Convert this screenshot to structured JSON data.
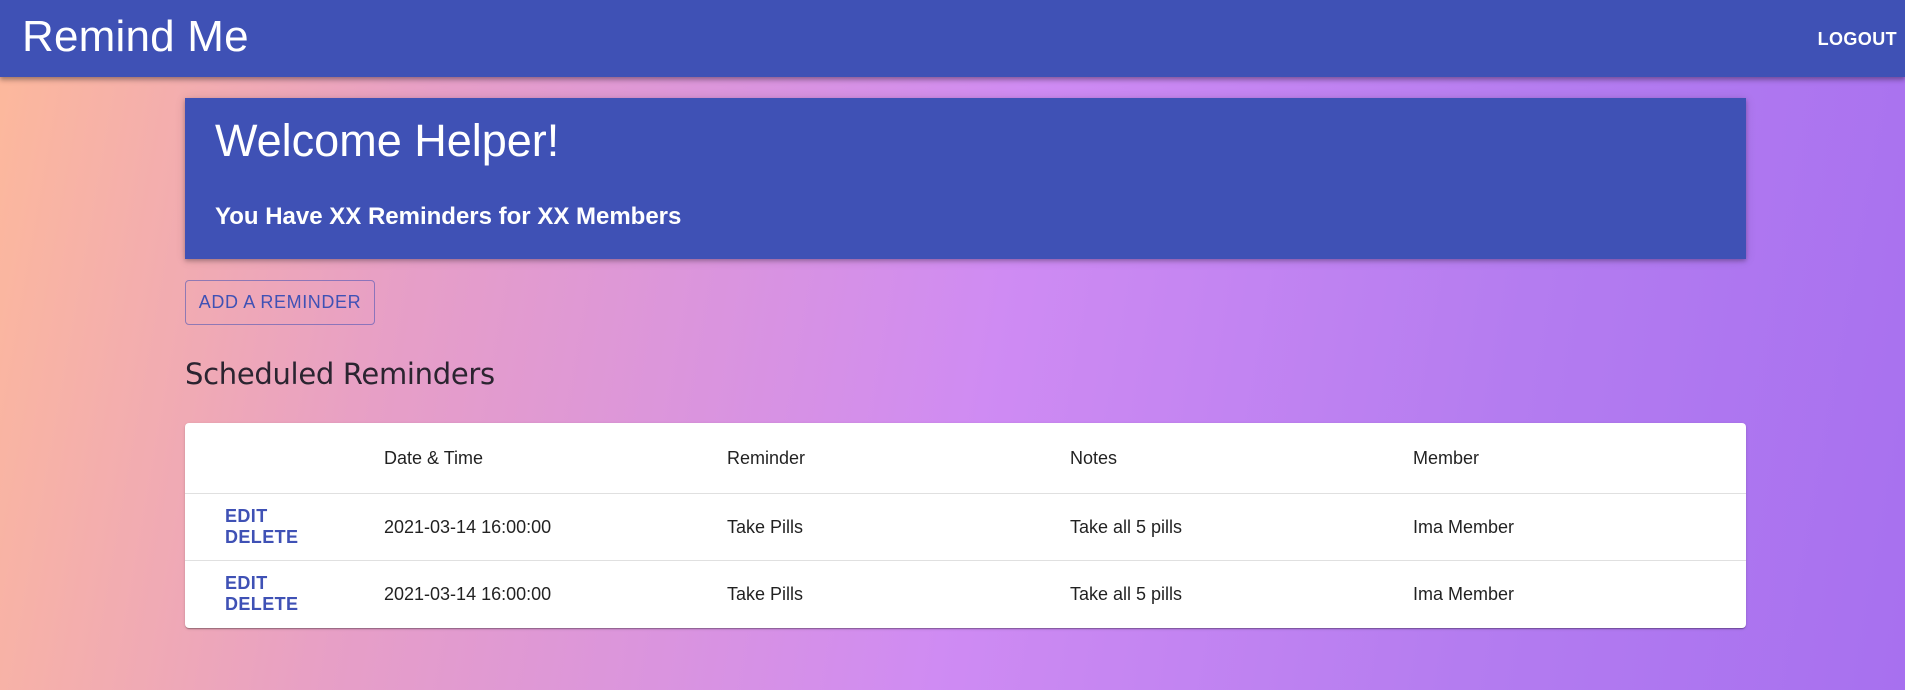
{
  "appbar": {
    "title": "Remind Me",
    "logout_label": "LOGOUT"
  },
  "welcome": {
    "title": "Welcome Helper!",
    "subtitle": "You Have XX Reminders for XX Members"
  },
  "add_button_label": "ADD A REMINDER",
  "section_title": "Scheduled Reminders",
  "table": {
    "headers": [
      "",
      "Date & Time",
      "Reminder",
      "Notes",
      "Member"
    ],
    "rows": [
      {
        "edit_label": "EDIT",
        "delete_label": "DELETE",
        "datetime": "2021-03-14 16:00:00",
        "reminder": "Take Pills",
        "notes": "Take all 5 pills",
        "member": "Ima Member"
      },
      {
        "edit_label": "EDIT",
        "delete_label": "DELETE",
        "datetime": "2021-03-14 16:00:00",
        "reminder": "Take Pills",
        "notes": "Take all 5 pills",
        "member": "Ima Member"
      }
    ]
  },
  "colors": {
    "primary": "#3f51b5",
    "background_gradient": [
      "#fdb99b",
      "#cf8bf3",
      "#a770ef"
    ]
  }
}
